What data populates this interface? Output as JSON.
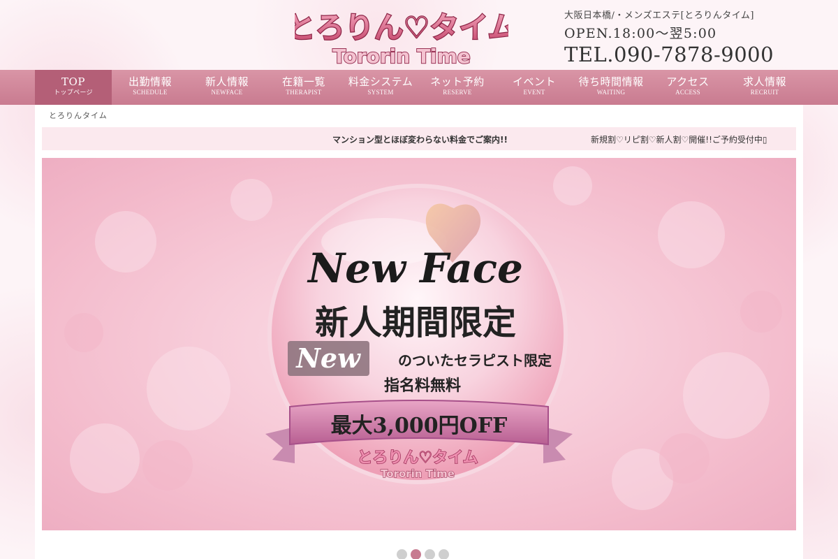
{
  "site": {
    "logo_text": "とろりん♡タイム",
    "logo_subtext": "Tororin Time"
  },
  "header": {
    "tagline": "大阪日本橋/・メンズエステ[とろりんタイム]",
    "hours": "OPEN.18:00～翌5:00",
    "tel": "TEL.090-7878-9000"
  },
  "nav": {
    "items": [
      {
        "label": "TOP",
        "sub": "トップページ"
      },
      {
        "label": "出勤情報",
        "sub": "SCHEDULE"
      },
      {
        "label": "新人情報",
        "sub": "NEWFACE"
      },
      {
        "label": "在籍一覧",
        "sub": "THERAPIST"
      },
      {
        "label": "料金システム",
        "sub": "SYSTEM"
      },
      {
        "label": "ネット予約",
        "sub": "RESERVE"
      },
      {
        "label": "イベント",
        "sub": "EVENT"
      },
      {
        "label": "待ち時間情報",
        "sub": "WAITING"
      },
      {
        "label": "アクセス",
        "sub": "ACCESS"
      },
      {
        "label": "求人情報",
        "sub": "RECRUIT"
      }
    ],
    "active_index": 0
  },
  "breadcrumb": "とろりんタイム",
  "ticker": {
    "message_1": "マンション型とほぼ変わらない料金でご案内!!",
    "message_2": "新規割♡リピ割♡新人割♡開催!!ご予約受付中▯"
  },
  "banner": {
    "headline": "New Face",
    "title": "新人期間限定",
    "badge": "New",
    "line1": "のついたセラピスト限定",
    "line2": "指名料無料",
    "ribbon": "最大3,000円OFF",
    "logo_text": "とろりん♡タイム",
    "logo_subtext": "Tororin Time"
  },
  "slider": {
    "count": 4,
    "active_index": 1
  },
  "colors": {
    "nav": "#d38a9e",
    "nav_active": "#b45f77",
    "accent": "#c77b90",
    "ticker_bg": "#fbe9ee"
  }
}
